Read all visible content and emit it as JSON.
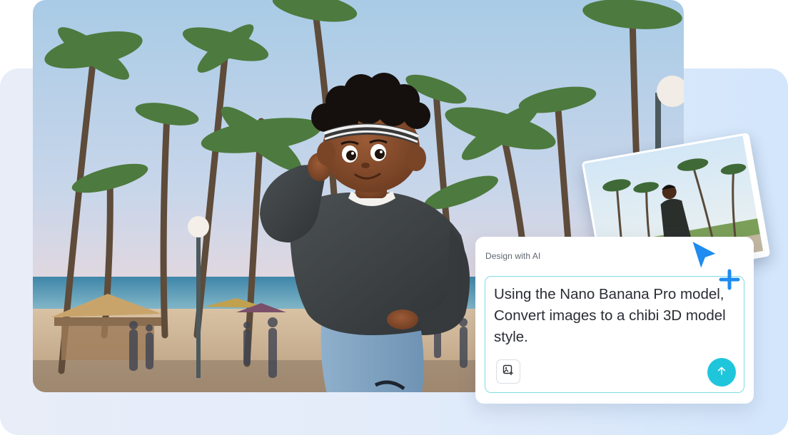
{
  "panel": {
    "title": "Design with AI",
    "prompt_text": "Using the Nano Banana Pro model, Convert images to a chibi 3D model style.",
    "upload_icon": "image-upload-icon",
    "send_icon": "arrow-up-icon"
  },
  "decor": {
    "cursor_icon": "pointer-plus-icon",
    "accent_color": "#1fc6db",
    "cursor_color": "#1e8cf0"
  }
}
